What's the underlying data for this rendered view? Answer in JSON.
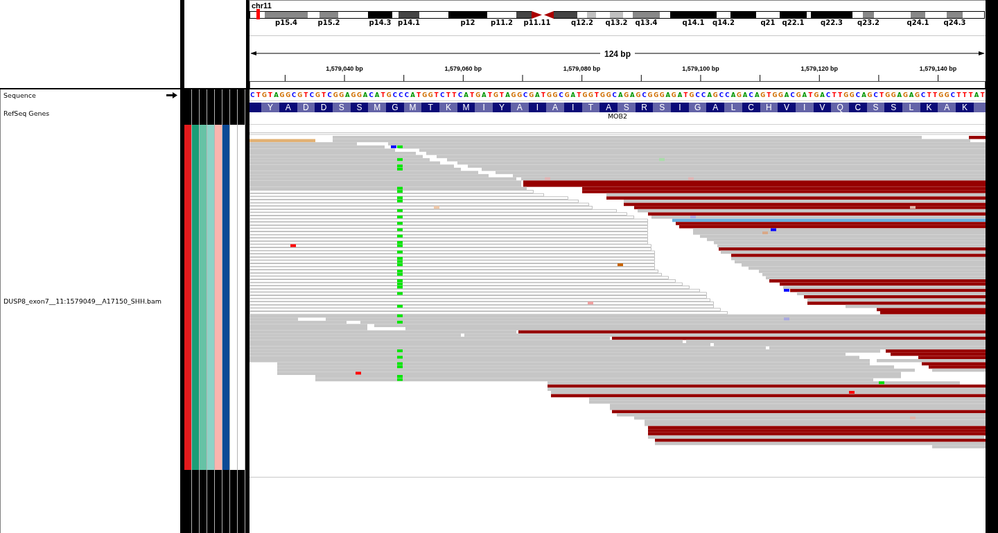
{
  "ideogram": {
    "chromosome": "chr11",
    "bands": [
      {
        "kind": "gneg"
      },
      {
        "kind": "gpos50",
        "label": "p15.4"
      },
      {
        "kind": "gneg"
      },
      {
        "kind": "gpos50",
        "label": "p15.2"
      },
      {
        "kind": "gneg"
      },
      {
        "kind": "gpos100",
        "label": "p14.3"
      },
      {
        "kind": "gneg"
      },
      {
        "kind": "gpos75",
        "label": "p14.1"
      },
      {
        "kind": "gneg"
      },
      {
        "kind": "gpos100",
        "label": "p12"
      },
      {
        "kind": "gneg",
        "label": "p11.2"
      },
      {
        "kind": "gpos75"
      },
      {
        "kind": "acen",
        "label": "p11.11"
      },
      {
        "kind": "acen"
      },
      {
        "kind": "gpos75"
      },
      {
        "kind": "gneg",
        "label": "q12.2"
      },
      {
        "kind": "gpos25"
      },
      {
        "kind": "gneg"
      },
      {
        "kind": "gpos25",
        "label": "q13.2"
      },
      {
        "kind": "gneg"
      },
      {
        "kind": "gpos50",
        "label": "q13.4"
      },
      {
        "kind": "gneg"
      },
      {
        "kind": "gpos100",
        "label": "q14.1"
      },
      {
        "kind": "gneg",
        "label": "q14.2"
      },
      {
        "kind": "gpos100"
      },
      {
        "kind": "gneg",
        "label": "q21"
      },
      {
        "kind": "gpos100",
        "label": "q22.1"
      },
      {
        "kind": "gneg"
      },
      {
        "kind": "gpos100",
        "label": "q22.3"
      },
      {
        "kind": "gneg"
      },
      {
        "kind": "gpos50",
        "label": "q23.2"
      },
      {
        "kind": "gneg"
      },
      {
        "kind": "gpos50",
        "label": "q24.1"
      },
      {
        "kind": "gneg"
      },
      {
        "kind": "gpos50",
        "label": "q24.3"
      },
      {
        "kind": "gneg"
      }
    ]
  },
  "ruler": {
    "span": "124 bp",
    "ticks": [
      "1,579,040 bp",
      "1,579,060 bp",
      "1,579,080 bp",
      "1,579,100 bp",
      "1,579,120 bp",
      "1,579,140 bp"
    ]
  },
  "tracks": [
    {
      "kind": "sequence",
      "name": "Sequence",
      "forward_strand": true,
      "bases": [
        {
          "base": "C",
          "color": "#0000ff"
        },
        {
          "base": "T",
          "color": "#ff0000"
        },
        {
          "base": "G",
          "color": "#d17105"
        },
        {
          "base": "T",
          "color": "#ff0000"
        },
        {
          "base": "A",
          "color": "#009600"
        },
        {
          "base": "G",
          "color": "#d17105"
        },
        {
          "base": "G",
          "color": "#d17105"
        },
        {
          "base": "C",
          "color": "#0000ff"
        },
        {
          "base": "G",
          "color": "#d17105"
        },
        {
          "base": "T",
          "color": "#ff0000"
        },
        {
          "base": "C",
          "color": "#0000ff"
        },
        {
          "base": "G",
          "color": "#d17105"
        },
        {
          "base": "T",
          "color": "#ff0000"
        },
        {
          "base": "C",
          "color": "#0000ff"
        },
        {
          "base": "G",
          "color": "#d17105"
        },
        {
          "base": "G",
          "color": "#d17105"
        },
        {
          "base": "A",
          "color": "#009600"
        },
        {
          "base": "G",
          "color": "#d17105"
        },
        {
          "base": "G",
          "color": "#d17105"
        },
        {
          "base": "A",
          "color": "#009600"
        },
        {
          "base": "C",
          "color": "#0000ff"
        },
        {
          "base": "A",
          "color": "#009600"
        },
        {
          "base": "T",
          "color": "#ff0000"
        },
        {
          "base": "G",
          "color": "#d17105"
        },
        {
          "base": "C",
          "color": "#0000ff"
        },
        {
          "base": "C",
          "color": "#0000ff"
        },
        {
          "base": "C",
          "color": "#0000ff"
        },
        {
          "base": "A",
          "color": "#009600"
        },
        {
          "base": "T",
          "color": "#ff0000"
        },
        {
          "base": "G",
          "color": "#d17105"
        },
        {
          "base": "G",
          "color": "#d17105"
        },
        {
          "base": "T",
          "color": "#ff0000"
        },
        {
          "base": "C",
          "color": "#0000ff"
        },
        {
          "base": "T",
          "color": "#ff0000"
        },
        {
          "base": "T",
          "color": "#ff0000"
        },
        {
          "base": "C",
          "color": "#0000ff"
        },
        {
          "base": "A",
          "color": "#009600"
        },
        {
          "base": "T",
          "color": "#ff0000"
        },
        {
          "base": "G",
          "color": "#d17105"
        },
        {
          "base": "A",
          "color": "#009600"
        },
        {
          "base": "T",
          "color": "#ff0000"
        },
        {
          "base": "G",
          "color": "#d17105"
        },
        {
          "base": "T",
          "color": "#ff0000"
        },
        {
          "base": "A",
          "color": "#009600"
        },
        {
          "base": "G",
          "color": "#d17105"
        },
        {
          "base": "G",
          "color": "#d17105"
        },
        {
          "base": "C",
          "color": "#0000ff"
        },
        {
          "base": "G",
          "color": "#d17105"
        },
        {
          "base": "A",
          "color": "#009600"
        },
        {
          "base": "T",
          "color": "#ff0000"
        },
        {
          "base": "G",
          "color": "#d17105"
        },
        {
          "base": "G",
          "color": "#d17105"
        },
        {
          "base": "C",
          "color": "#0000ff"
        },
        {
          "base": "G",
          "color": "#d17105"
        },
        {
          "base": "A",
          "color": "#009600"
        },
        {
          "base": "T",
          "color": "#ff0000"
        },
        {
          "base": "G",
          "color": "#d17105"
        },
        {
          "base": "G",
          "color": "#d17105"
        },
        {
          "base": "T",
          "color": "#ff0000"
        },
        {
          "base": "G",
          "color": "#d17105"
        },
        {
          "base": "G",
          "color": "#d17105"
        },
        {
          "base": "C",
          "color": "#0000ff"
        },
        {
          "base": "A",
          "color": "#009600"
        },
        {
          "base": "G",
          "color": "#d17105"
        },
        {
          "base": "A",
          "color": "#009600"
        },
        {
          "base": "G",
          "color": "#d17105"
        },
        {
          "base": "C",
          "color": "#0000ff"
        },
        {
          "base": "G",
          "color": "#d17105"
        },
        {
          "base": "G",
          "color": "#d17105"
        },
        {
          "base": "G",
          "color": "#d17105"
        },
        {
          "base": "A",
          "color": "#009600"
        },
        {
          "base": "G",
          "color": "#d17105"
        },
        {
          "base": "A",
          "color": "#009600"
        },
        {
          "base": "T",
          "color": "#ff0000"
        },
        {
          "base": "G",
          "color": "#d17105"
        },
        {
          "base": "C",
          "color": "#0000ff"
        },
        {
          "base": "C",
          "color": "#0000ff"
        },
        {
          "base": "A",
          "color": "#009600"
        },
        {
          "base": "G",
          "color": "#d17105"
        },
        {
          "base": "C",
          "color": "#0000ff"
        },
        {
          "base": "C",
          "color": "#0000ff"
        },
        {
          "base": "A",
          "color": "#009600"
        },
        {
          "base": "G",
          "color": "#d17105"
        },
        {
          "base": "A",
          "color": "#009600"
        },
        {
          "base": "C",
          "color": "#0000ff"
        },
        {
          "base": "A",
          "color": "#009600"
        },
        {
          "base": "G",
          "color": "#d17105"
        },
        {
          "base": "T",
          "color": "#ff0000"
        },
        {
          "base": "G",
          "color": "#d17105"
        },
        {
          "base": "G",
          "color": "#d17105"
        },
        {
          "base": "A",
          "color": "#009600"
        },
        {
          "base": "C",
          "color": "#0000ff"
        },
        {
          "base": "G",
          "color": "#d17105"
        },
        {
          "base": "A",
          "color": "#009600"
        },
        {
          "base": "T",
          "color": "#ff0000"
        },
        {
          "base": "G",
          "color": "#d17105"
        },
        {
          "base": "A",
          "color": "#009600"
        },
        {
          "base": "C",
          "color": "#0000ff"
        },
        {
          "base": "T",
          "color": "#ff0000"
        },
        {
          "base": "T",
          "color": "#ff0000"
        },
        {
          "base": "G",
          "color": "#d17105"
        },
        {
          "base": "G",
          "color": "#d17105"
        },
        {
          "base": "C",
          "color": "#0000ff"
        },
        {
          "base": "A",
          "color": "#009600"
        },
        {
          "base": "G",
          "color": "#d17105"
        },
        {
          "base": "C",
          "color": "#0000ff"
        },
        {
          "base": "T",
          "color": "#ff0000"
        },
        {
          "base": "G",
          "color": "#d17105"
        },
        {
          "base": "G",
          "color": "#d17105"
        },
        {
          "base": "A",
          "color": "#009600"
        },
        {
          "base": "G",
          "color": "#d17105"
        },
        {
          "base": "A",
          "color": "#009600"
        },
        {
          "base": "G",
          "color": "#d17105"
        },
        {
          "base": "C",
          "color": "#0000ff"
        },
        {
          "base": "T",
          "color": "#ff0000"
        },
        {
          "base": "T",
          "color": "#ff0000"
        },
        {
          "base": "G",
          "color": "#d17105"
        },
        {
          "base": "G",
          "color": "#d17105"
        },
        {
          "base": "C",
          "color": "#0000ff"
        },
        {
          "base": "T",
          "color": "#ff0000"
        },
        {
          "base": "T",
          "color": "#ff0000"
        },
        {
          "base": "T",
          "color": "#ff0000"
        },
        {
          "base": "A",
          "color": "#009600"
        },
        {
          "base": "T",
          "color": "#ff0000"
        }
      ]
    },
    {
      "kind": "gene",
      "name": "RefSeq Genes",
      "gene": "MOB2",
      "amino_acids": {
        "leading_partial": true,
        "residues": [
          "Y",
          "A",
          "D",
          "D",
          "S",
          "S",
          "M",
          "G",
          "M",
          "T",
          "K",
          "M",
          "I",
          "Y",
          "A",
          "I",
          "A",
          "I",
          "T",
          "A",
          "S",
          "R",
          "S",
          "I",
          "G",
          "A",
          "L",
          "C",
          "H",
          "V",
          "I",
          "V",
          "Q",
          "C",
          "S",
          "S",
          "L",
          "K",
          "A",
          "K"
        ],
        "trailing_partial": true
      }
    },
    {
      "kind": "alignment",
      "name": "DUSP8_exon7__11:1579049__A17150_SHH.bam",
      "attributes": [
        {
          "color": "#e41a1c"
        },
        {
          "color": "#1b9e77"
        },
        {
          "color": "#66c2a5"
        },
        {
          "color": "#8dd3c7"
        },
        {
          "color": "#fbb4ae"
        },
        {
          "color": "#0c4a96"
        },
        {
          "color": "#ffffff"
        },
        {
          "color": "#ffffff"
        }
      ]
    }
  ]
}
